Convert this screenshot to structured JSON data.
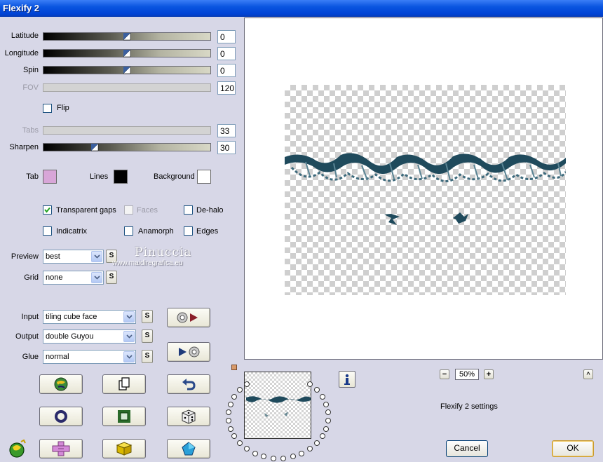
{
  "window": {
    "title": "Flexify 2"
  },
  "sliders": {
    "latitude": {
      "label": "Latitude",
      "value": "0"
    },
    "longitude": {
      "label": "Longitude",
      "value": "0"
    },
    "spin": {
      "label": "Spin",
      "value": "0"
    },
    "fov": {
      "label": "FOV",
      "value": "120"
    },
    "tabs": {
      "label": "Tabs",
      "value": "33"
    },
    "sharpen": {
      "label": "Sharpen",
      "value": "30"
    }
  },
  "flip": {
    "label": "Flip",
    "checked": false
  },
  "colors": {
    "tab": {
      "label": "Tab",
      "color": "#d8a6d8"
    },
    "lines": {
      "label": "Lines",
      "color": "#000000"
    },
    "background": {
      "label": "Background",
      "color": "#ffffff"
    }
  },
  "options": {
    "transparent_gaps": {
      "label": "Transparent gaps",
      "checked": true
    },
    "faces": {
      "label": "Faces",
      "checked": false
    },
    "de_halo": {
      "label": "De-halo",
      "checked": false
    },
    "indicatrix": {
      "label": "Indicatrix",
      "checked": false
    },
    "anamorph": {
      "label": "Anamorph",
      "checked": false
    },
    "edges": {
      "label": "Edges",
      "checked": false
    }
  },
  "selects": {
    "preview": {
      "label": "Preview",
      "value": "best"
    },
    "grid": {
      "label": "Grid",
      "value": "none"
    },
    "input": {
      "label": "Input",
      "value": "tiling cube face"
    },
    "output": {
      "label": "Output",
      "value": "double Guyou"
    },
    "glue": {
      "label": "Glue",
      "value": "normal"
    }
  },
  "small_button_label": "S",
  "watermark": {
    "line1": "Pinuccia",
    "line2": "www.maidiregrafica.eu"
  },
  "zoom": {
    "value": "50%",
    "minus": "−",
    "plus": "+"
  },
  "status": "Flexify 2 settings",
  "collapse_button": "^",
  "buttons": {
    "cancel": "Cancel",
    "ok": "OK"
  },
  "icons": {
    "swap_input": "input-to-output-icon",
    "swap_output": "output-to-input-icon",
    "randomize": "globe-icon",
    "copy": "copy-icon",
    "undo": "undo-icon",
    "ring": "ring-icon",
    "frame": "frame-icon",
    "dice": "dice-icon",
    "cross": "cross-icon",
    "cube": "cube-icon",
    "pentagon": "pentagon-icon",
    "app_logo": "flexify-logo-icon",
    "info": "info-icon"
  },
  "accent_colors": {
    "titlebar": "#0a55e0",
    "panel": "#d7d7e7",
    "design": "#1f4a5c"
  }
}
